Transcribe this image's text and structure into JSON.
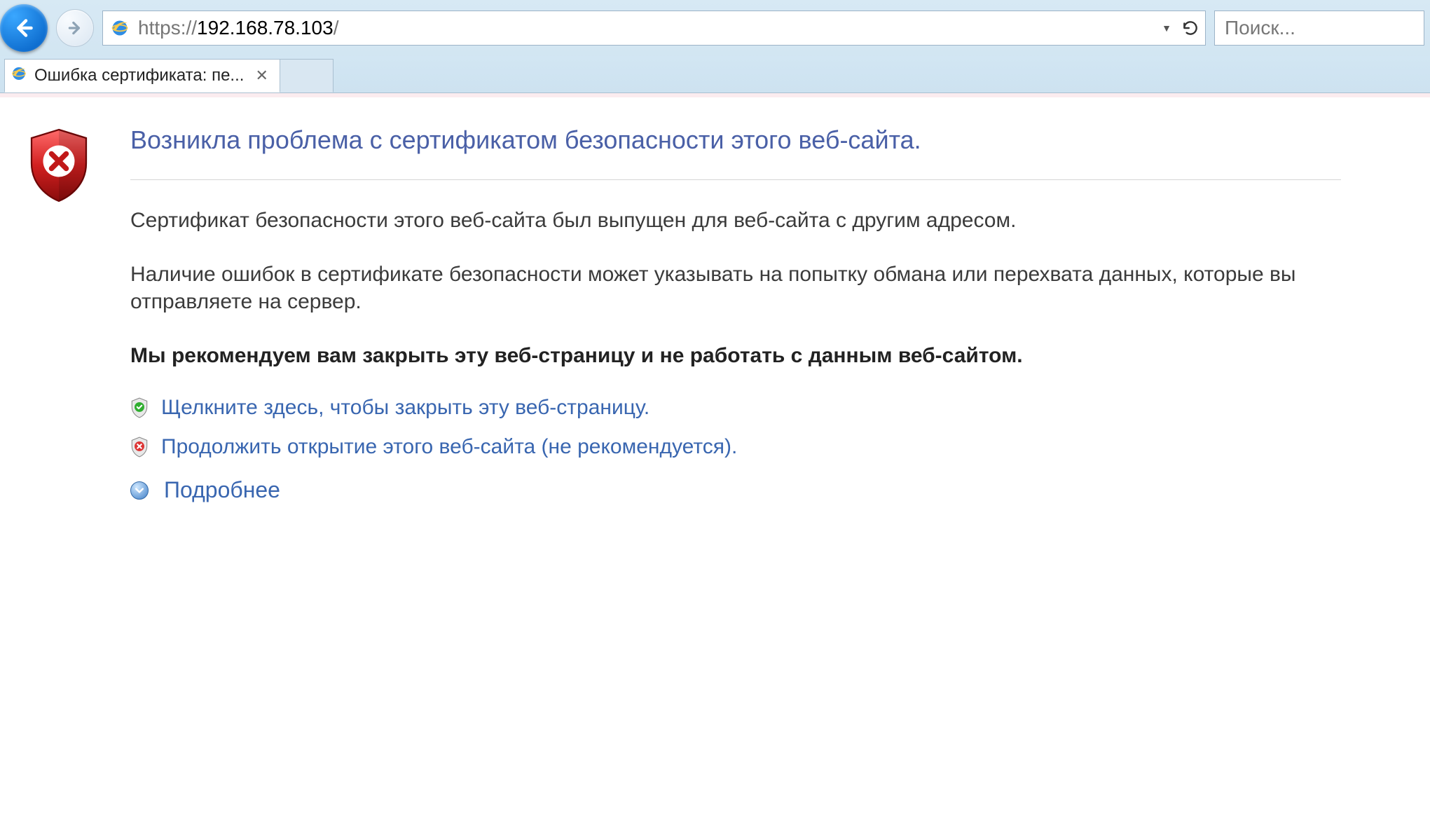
{
  "browser": {
    "address": {
      "prefix": "https://",
      "host": "192.168.78.103",
      "suffix": "/"
    },
    "search_placeholder": "Поиск...",
    "tab_title": "Ошибка сертификата: пе..."
  },
  "page": {
    "heading": "Возникла проблема с сертификатом безопасности этого веб-сайта.",
    "para1": "Сертификат безопасности этого веб-сайта был выпущен для веб-сайта с другим адресом.",
    "para2": "Наличие ошибок в сертификате безопасности может указывать на попытку обмана или перехвата данных, которые вы отправляете на сервер.",
    "recommend": "Мы рекомендуем вам закрыть эту веб-страницу и не работать с данным веб-сайтом.",
    "link_close": "Щелкните здесь, чтобы закрыть эту веб-страницу.",
    "link_proceed": "Продолжить открытие этого веб-сайта (не рекомендуется).",
    "link_more": "Подробнее"
  }
}
